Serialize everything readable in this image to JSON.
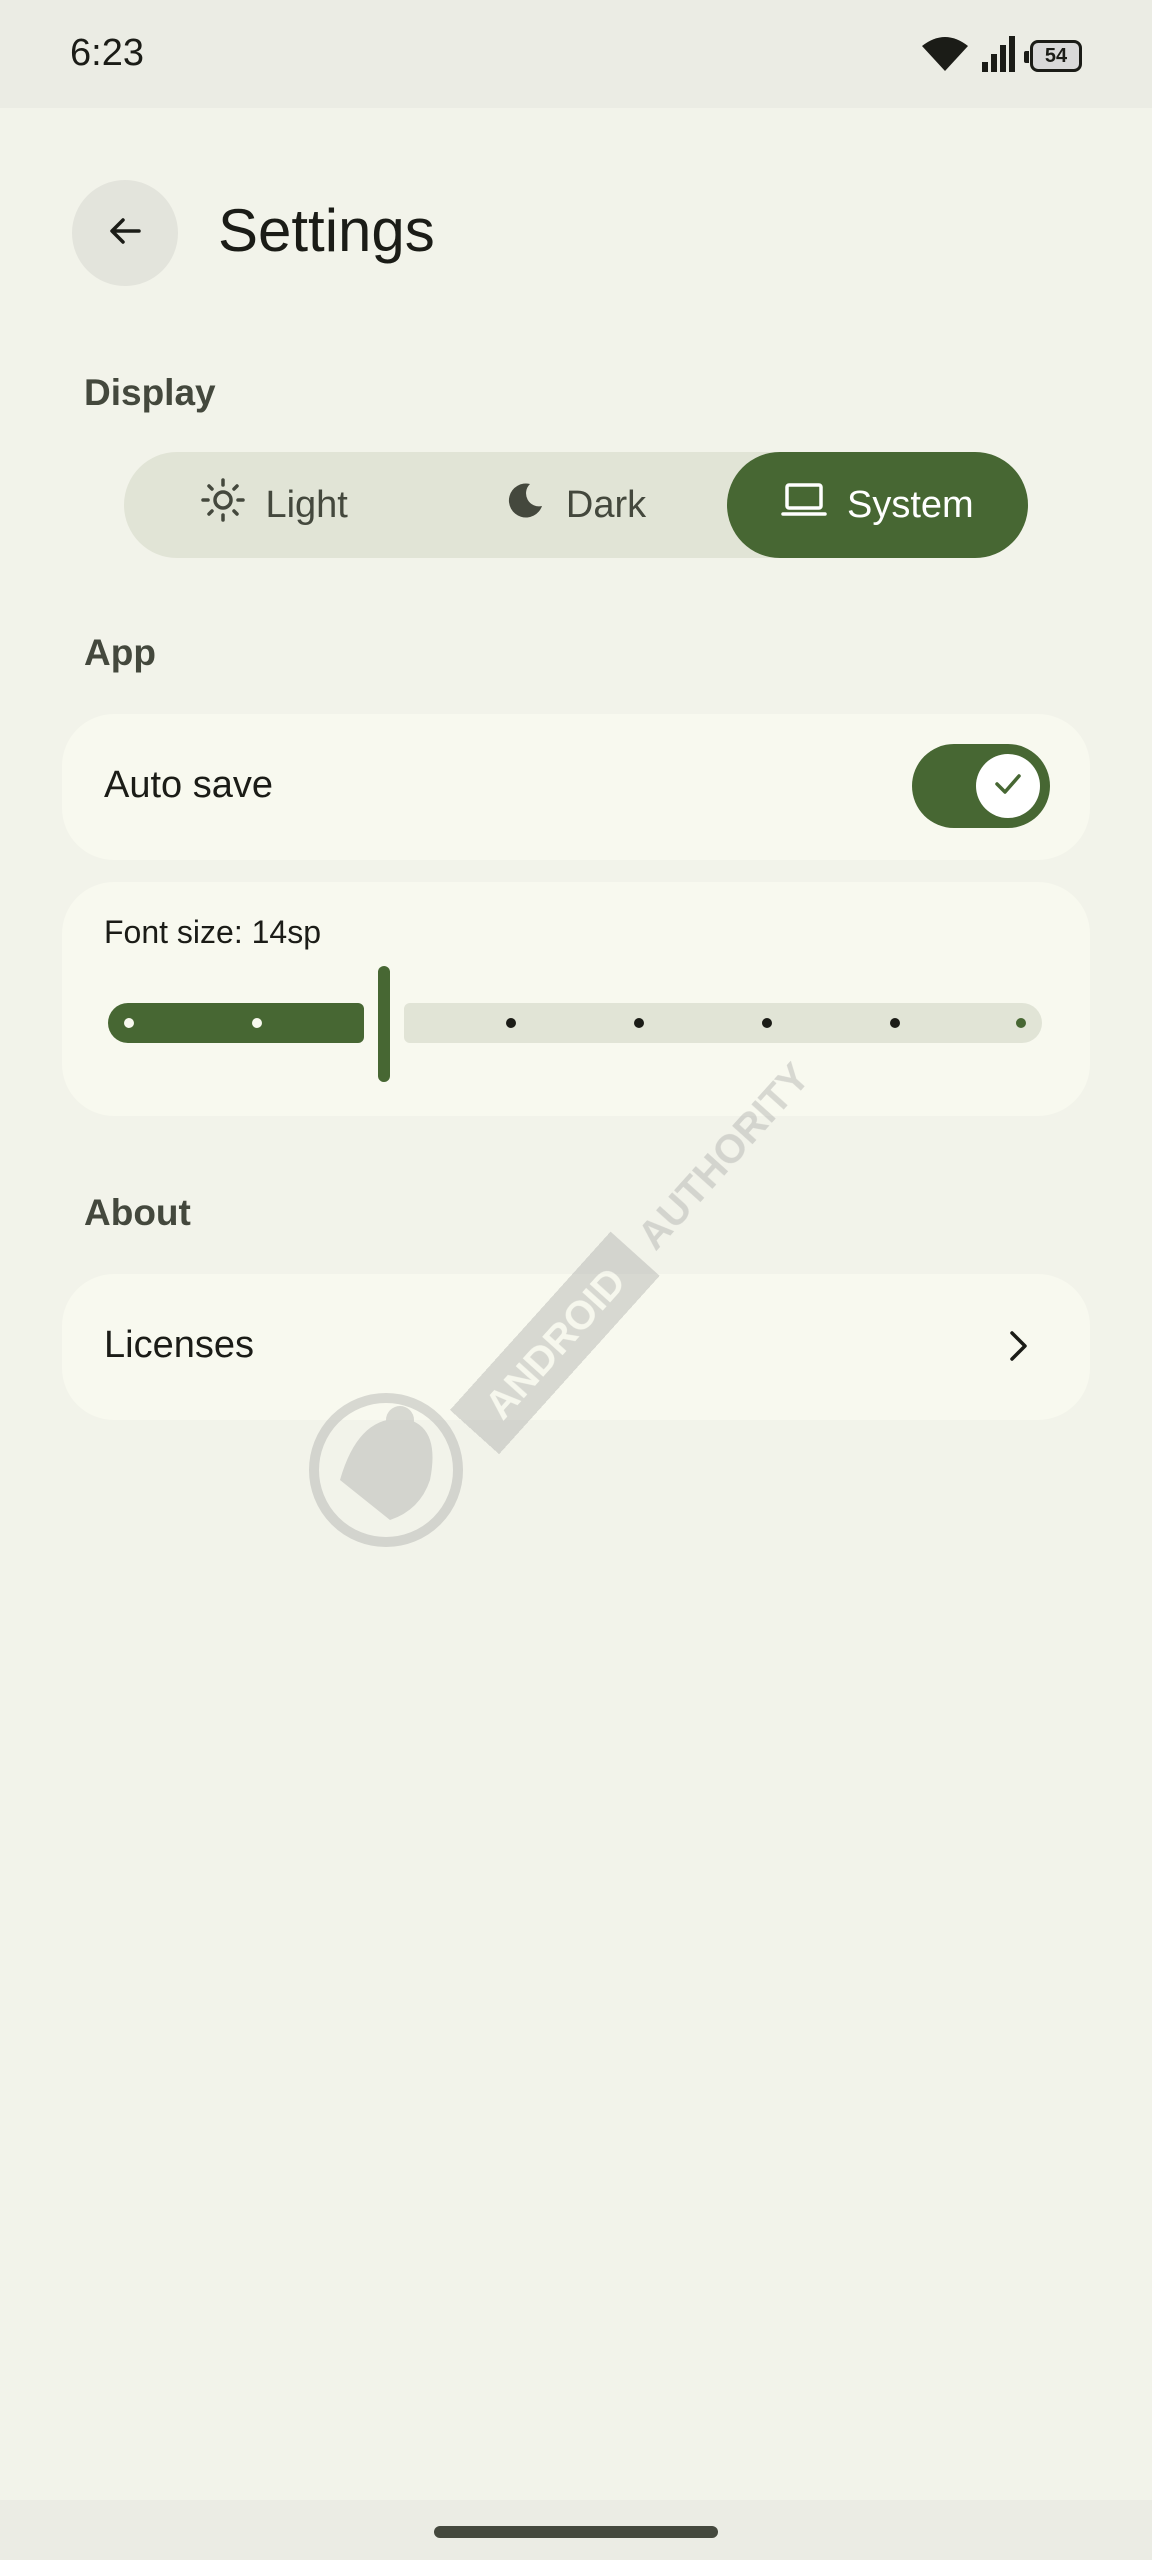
{
  "status_bar": {
    "time": "6:23",
    "battery": "54",
    "icons": [
      "wifi-icon",
      "signal-icon",
      "battery-icon"
    ]
  },
  "header": {
    "title": "Settings",
    "back_icon": "arrow-left-icon"
  },
  "display_section": {
    "header": "Display",
    "options": [
      {
        "label": "Light",
        "icon": "sun-icon",
        "selected": false
      },
      {
        "label": "Dark",
        "icon": "moon-icon",
        "selected": false
      },
      {
        "label": "System",
        "icon": "laptop-icon",
        "selected": true
      }
    ]
  },
  "app_section": {
    "header": "App",
    "auto_save": {
      "label": "Auto save",
      "enabled": true
    },
    "font_size": {
      "label": "Font size: 14sp",
      "value_step": 2,
      "step_count": 8
    }
  },
  "about_section": {
    "header": "About",
    "licenses_label": "Licenses"
  },
  "watermark": "ANDROID AUTHORITY",
  "colors": {
    "accent": "#476733",
    "background": "#f2f3ea",
    "card": "#f8f9ef",
    "inactive_track": "#e1e4d6"
  }
}
